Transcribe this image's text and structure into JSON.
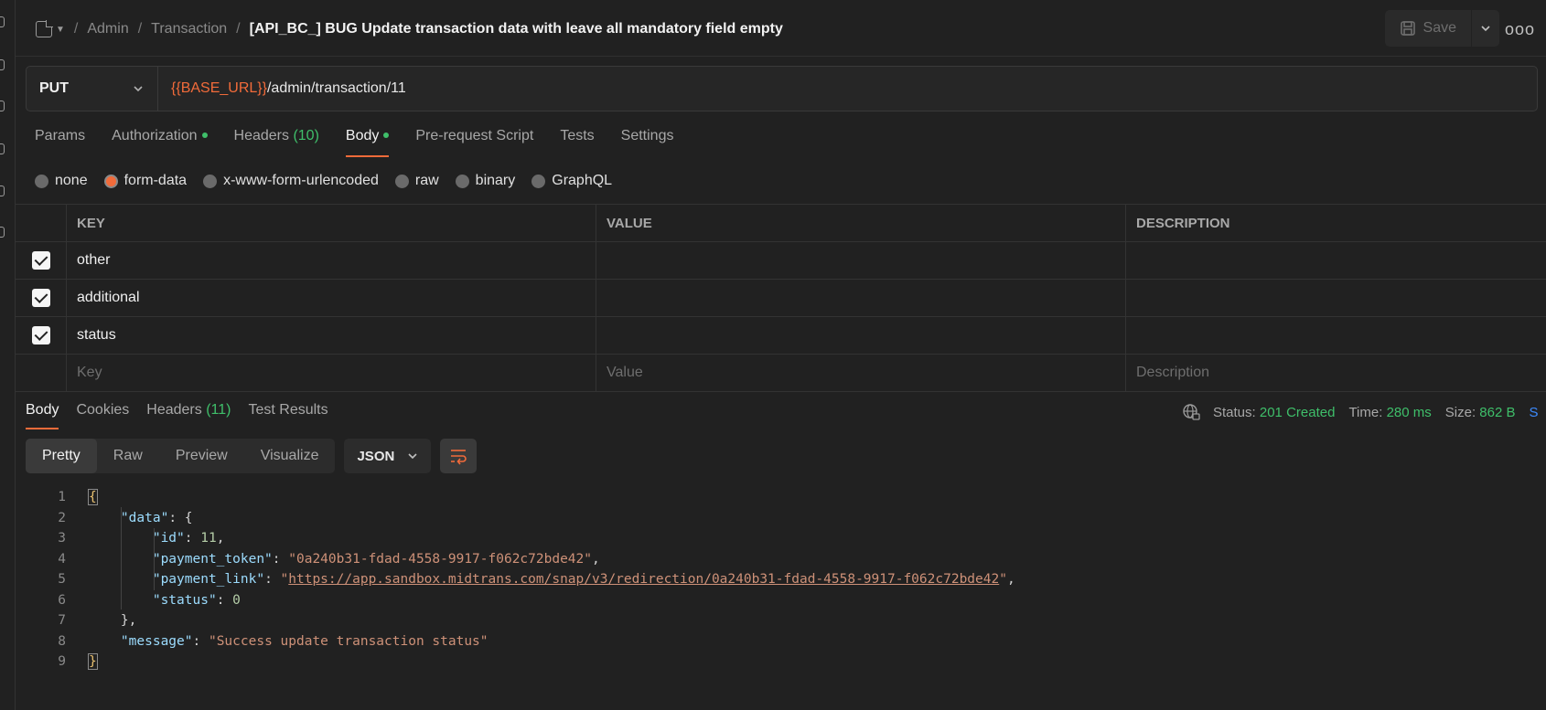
{
  "header": {
    "breadcrumbs": [
      "Admin",
      "Transaction"
    ],
    "title": "[API_BC_] BUG Update transaction data with leave all mandatory field empty",
    "save_label": "Save",
    "more_label": "ooo"
  },
  "request": {
    "method": "PUT",
    "url_variable": "{{BASE_URL}}",
    "url_path": "/admin/transaction/11"
  },
  "request_tabs": {
    "params": "Params",
    "authorization": "Authorization",
    "headers": "Headers",
    "headers_count": "(10)",
    "body": "Body",
    "prerequest": "Pre-request Script",
    "tests": "Tests",
    "settings": "Settings"
  },
  "body_types": {
    "none": "none",
    "form_data": "form-data",
    "urlencoded": "x-www-form-urlencoded",
    "raw": "raw",
    "binary": "binary",
    "graphql": "GraphQL",
    "selected": "form-data"
  },
  "form_table": {
    "headers": {
      "key": "KEY",
      "value": "VALUE",
      "description": "DESCRIPTION"
    },
    "rows": [
      {
        "key": "other",
        "value": "",
        "description": "",
        "checked": true
      },
      {
        "key": "additional",
        "value": "",
        "description": "",
        "checked": true
      },
      {
        "key": "status",
        "value": "",
        "description": "",
        "checked": true
      }
    ],
    "placeholders": {
      "key": "Key",
      "value": "Value",
      "description": "Description"
    }
  },
  "response": {
    "tabs": {
      "body": "Body",
      "cookies": "Cookies",
      "headers": "Headers",
      "headers_count": "(11)",
      "test_results": "Test Results"
    },
    "status_label": "Status:",
    "status_value": "201 Created",
    "time_label": "Time:",
    "time_value": "280 ms",
    "size_label": "Size:",
    "size_value": "862 B",
    "save_response_label": "S",
    "view_modes": {
      "pretty": "Pretty",
      "raw": "Raw",
      "preview": "Preview",
      "visualize": "Visualize"
    },
    "format": "JSON",
    "code": {
      "line_numbers": [
        "1",
        "2",
        "3",
        "4",
        "5",
        "6",
        "7",
        "8",
        "9"
      ],
      "key_data": "\"data\"",
      "key_id": "\"id\"",
      "val_id": "11",
      "key_payment_token": "\"payment_token\"",
      "val_payment_token": "\"0a240b31-fdad-4558-9917-f062c72bde42\"",
      "key_payment_link": "\"payment_link\"",
      "val_payment_link_url": "https://app.sandbox.midtrans.com/snap/v3/redirection/0a240b31-fdad-4558-9917-f062c72bde42",
      "key_status": "\"status\"",
      "val_status": "0",
      "key_message": "\"message\"",
      "val_message": "\"Success update transaction status\""
    }
  },
  "colors": {
    "accent": "#f26b3a",
    "success": "#3fbf6a",
    "background": "#212121"
  }
}
